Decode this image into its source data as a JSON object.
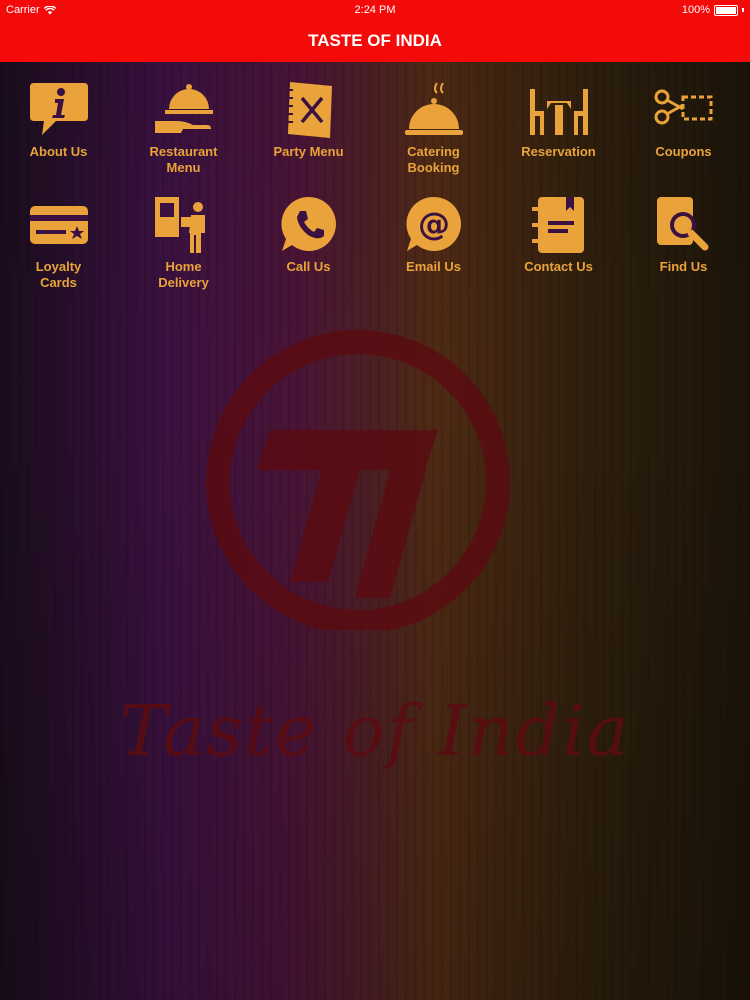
{
  "status_bar": {
    "carrier": "Carrier",
    "time": "2:24 PM",
    "battery": "100%"
  },
  "header": {
    "title": "TASTE OF INDIA"
  },
  "menu": [
    {
      "label": "About Us",
      "icon": "info-bubble-icon"
    },
    {
      "label": "Restaurant\nMenu",
      "icon": "cloche-hand-icon"
    },
    {
      "label": "Party Menu",
      "icon": "menu-book-icon"
    },
    {
      "label": "Catering\nBooking",
      "icon": "catering-cloche-icon"
    },
    {
      "label": "Reservation",
      "icon": "table-chairs-icon"
    },
    {
      "label": "Coupons",
      "icon": "scissors-coupon-icon"
    },
    {
      "label": "Loyalty\nCards",
      "icon": "loyalty-card-icon"
    },
    {
      "label": "Home\nDelivery",
      "icon": "delivery-person-icon"
    },
    {
      "label": "Call Us",
      "icon": "phone-bubble-icon"
    },
    {
      "label": "Email Us",
      "icon": "at-bubble-icon"
    },
    {
      "label": "Contact Us",
      "icon": "contact-book-icon"
    },
    {
      "label": "Find Us",
      "icon": "magnifier-map-icon"
    }
  ],
  "watermark": {
    "logo_text": "Taste of India"
  },
  "colors": {
    "header": "#f50a0a",
    "icon_gold": "#e9a33a",
    "watermark": "#5a0c12"
  }
}
